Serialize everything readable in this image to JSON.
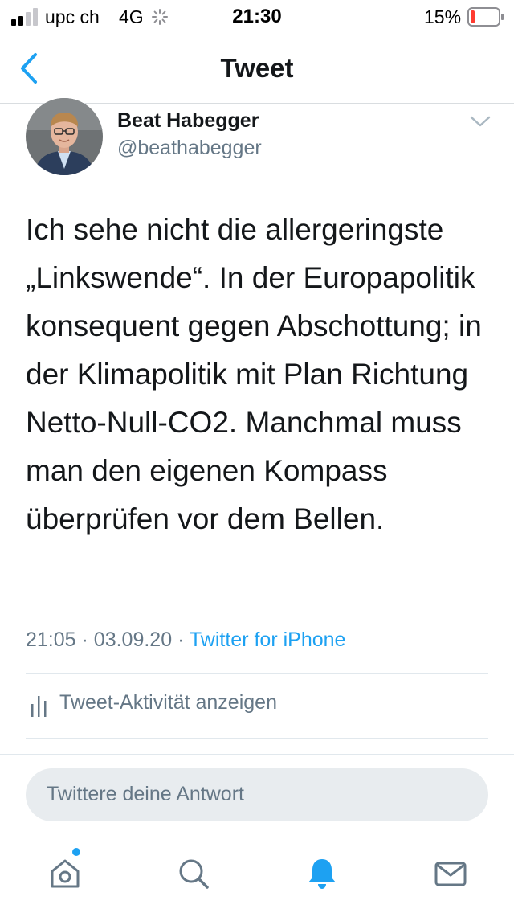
{
  "status_bar": {
    "carrier": "upc ch",
    "network": "4G",
    "time": "21:30",
    "battery_percent": "15%",
    "battery_level": 0.15,
    "battery_color": "#ff3b30"
  },
  "navbar": {
    "back_icon": "chevron-left-icon",
    "title": "Tweet"
  },
  "tweet": {
    "author_name": "Beat Habegger",
    "author_handle": "@beathabegger",
    "text": "Ich sehe nicht die allergeringste „Linkswende“. In der Europapolitik konsequent gegen Abschottung; in der Klimapolitik mit Plan Richtung Netto-Null-CO2. Manchmal muss man den eigenen Kompass überprüfen vor dem Bellen.",
    "time": "21:05",
    "separator": "·",
    "date": "03.09.20",
    "source": "Twitter for iPhone"
  },
  "activity": {
    "icon": "bar-chart-icon",
    "label": "Tweet-Aktivität anzeigen"
  },
  "reply": {
    "placeholder": "Twittere deine Antwort"
  },
  "tab_bar": {
    "items": [
      {
        "icon": "home-icon",
        "active": false,
        "badge": true
      },
      {
        "icon": "search-icon",
        "active": false
      },
      {
        "icon": "bell-icon",
        "active": true
      },
      {
        "icon": "mail-icon",
        "active": false
      }
    ]
  },
  "colors": {
    "accent": "#1da1f2",
    "secondary_text": "#657786",
    "primary_text": "#14171a"
  }
}
